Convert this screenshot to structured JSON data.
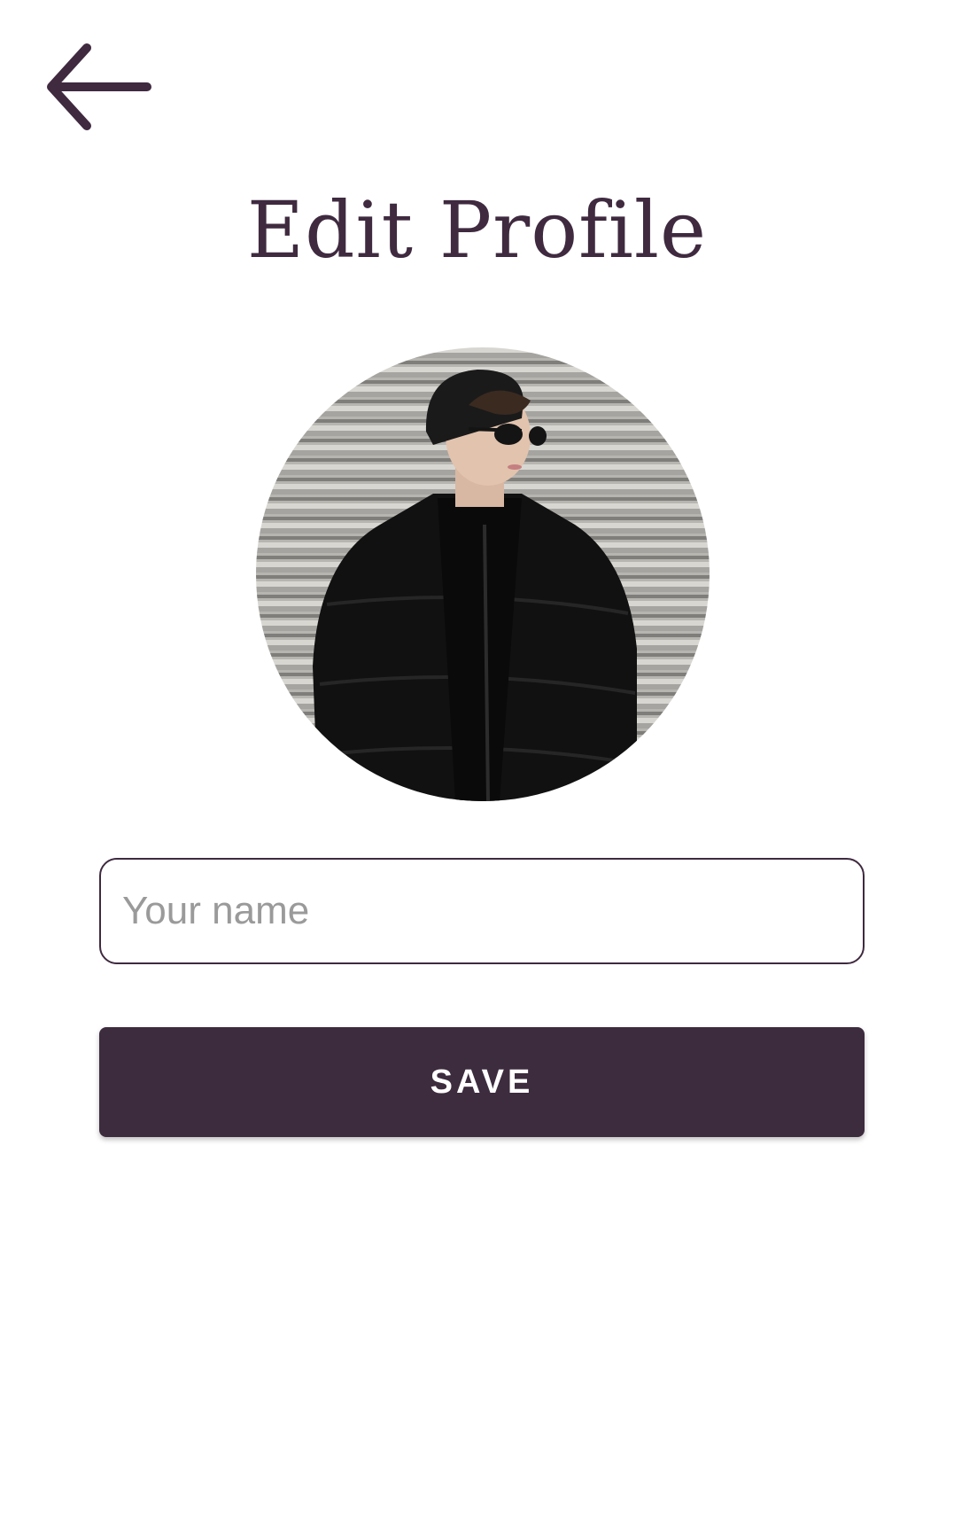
{
  "header": {
    "back_icon": "arrow-left-icon",
    "title": "Edit Profile"
  },
  "profile": {
    "avatar_description_icon": "profile-photo"
  },
  "form": {
    "name_placeholder": "Your name",
    "name_value": "",
    "save_label": "SAVE"
  },
  "colors": {
    "primary": "#3d2b3e",
    "placeholder": "#9a9a9a",
    "background": "#ffffff"
  }
}
